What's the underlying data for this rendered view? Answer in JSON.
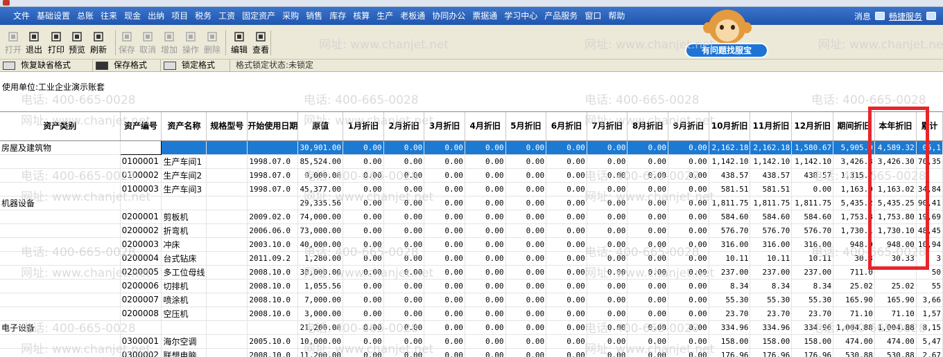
{
  "menu": {
    "items": [
      "文件",
      "基础设置",
      "总账",
      "往来",
      "现金",
      "出纳",
      "项目",
      "税务",
      "工资",
      "固定资产",
      "采购",
      "销售",
      "库存",
      "核算",
      "生产",
      "老板通",
      "协同办公",
      "票据通",
      "学习中心",
      "产品服务",
      "窗口",
      "帮助"
    ],
    "message": "消息",
    "quick_service": "畅捷服务"
  },
  "toolbar": {
    "buttons": [
      {
        "label": "打开",
        "icon": "open-folder-icon",
        "enabled": false
      },
      {
        "label": "退出",
        "icon": "exit-door-icon",
        "enabled": true
      },
      {
        "label": "打印",
        "icon": "printer-icon",
        "enabled": true
      },
      {
        "label": "预览",
        "icon": "preview-icon",
        "enabled": true
      },
      {
        "label": "刷新",
        "icon": "refresh-icon",
        "enabled": true
      },
      {
        "label": "保存",
        "icon": "save-disk-icon",
        "enabled": false
      },
      {
        "label": "取消",
        "icon": "cancel-icon",
        "enabled": false
      },
      {
        "label": "增加",
        "icon": "add-icon",
        "enabled": false
      },
      {
        "label": "操作",
        "icon": "operate-icon",
        "enabled": false
      },
      {
        "label": "删除",
        "icon": "delete-x-icon",
        "enabled": false
      },
      {
        "label": "编辑",
        "icon": "edit-icon",
        "enabled": true
      },
      {
        "label": "查看",
        "icon": "view-icon",
        "enabled": true
      }
    ]
  },
  "helper": {
    "bubble": "有问题找服宝"
  },
  "format_bar": {
    "restore": "恢复缺省格式",
    "save": "保存格式",
    "lock": "锁定格式",
    "status": "格式锁定状态:未锁定"
  },
  "report": {
    "unit_label": "使用单位:工业企业演示账套"
  },
  "watermark": {
    "phone": "电话: 400-665-0028",
    "site": "网址: www.chanjet.net"
  },
  "table": {
    "headers": [
      "资产类别",
      "资产编号",
      "资产名称",
      "规格型号",
      "开始使用日期",
      "原值",
      "1月折旧",
      "2月折旧",
      "3月折旧",
      "4月折旧",
      "5月折旧",
      "6月折旧",
      "7月折旧",
      "8月折旧",
      "9月折旧",
      "10月折旧",
      "11月折旧",
      "12月折旧",
      "期间折旧",
      "本年折旧",
      "累计"
    ],
    "rows": [
      {
        "cat": "房屋及建筑物",
        "code": "",
        "name": "",
        "spec": "",
        "date": "",
        "orig": "30,901.00",
        "m": [
          "0.00",
          "0.00",
          "0.00",
          "0.00",
          "0.00",
          "0.00",
          "0.00",
          "0.00",
          "0.00",
          "2,162.18",
          "2,162.18",
          "1,580.67"
        ],
        "period": "5,905.0",
        "year": "4,589.32",
        "acc": "05,1",
        "selected": true
      },
      {
        "cat": "",
        "code": "0100001",
        "name": "生产车间1",
        "spec": "",
        "date": "1998.07.0",
        "orig": "85,524.00",
        "m": [
          "0.00",
          "0.00",
          "0.00",
          "0.00",
          "0.00",
          "0.00",
          "0.00",
          "0.00",
          "0.00",
          "1,142.10",
          "1,142.10",
          "1,142.10"
        ],
        "period": "3,426.3",
        "year": "3,426.30",
        "acc": "70,35"
      },
      {
        "cat": "",
        "code": "0100002",
        "name": "生产车间2",
        "spec": "",
        "date": "1998.07.0",
        "orig": "0,000.00",
        "m": [
          "0.00",
          "0.00",
          "0.00",
          "0.00",
          "0.00",
          "0.00",
          "0.00",
          "0.00",
          "0.00",
          "438.57",
          "438.57",
          "438.57"
        ],
        "period": "1,315.7",
        "year": "",
        "acc": ""
      },
      {
        "cat": "",
        "code": "0100003",
        "name": "生产车间3",
        "spec": "",
        "date": "1998.07.0",
        "orig": "45,377.00",
        "m": [
          "0.00",
          "0.00",
          "0.00",
          "0.00",
          "0.00",
          "0.00",
          "0.00",
          "0.00",
          "0.00",
          "581.51",
          "581.51",
          "0.00"
        ],
        "period": "1,163.0",
        "year": "1,163.02",
        "acc": "34,84"
      },
      {
        "cat": "机器设备",
        "code": "",
        "name": "",
        "spec": "",
        "date": "",
        "orig": "29,335.56",
        "m": [
          "0.00",
          "0.00",
          "0.00",
          "0.00",
          "0.00",
          "0.00",
          "0.00",
          "0.00",
          "0.00",
          "1,811.75",
          "1,811.75",
          "1,811.75"
        ],
        "period": "5,435.2",
        "year": "5,435.25",
        "acc": "90,41"
      },
      {
        "cat": "",
        "code": "0200001",
        "name": "剪板机",
        "spec": "",
        "date": "2009.02.0",
        "orig": "74,000.00",
        "m": [
          "0.00",
          "0.00",
          "0.00",
          "0.00",
          "0.00",
          "0.00",
          "0.00",
          "0.00",
          "0.00",
          "584.60",
          "584.60",
          "584.60"
        ],
        "period": "1,753.8",
        "year": "1,753.80",
        "acc": "19,69"
      },
      {
        "cat": "",
        "code": "0200002",
        "name": "折弯机",
        "spec": "",
        "date": "2006.06.0",
        "orig": "73,000.00",
        "m": [
          "0.00",
          "0.00",
          "0.00",
          "0.00",
          "0.00",
          "0.00",
          "0.00",
          "0.00",
          "0.00",
          "576.70",
          "576.70",
          "576.70"
        ],
        "period": "1,730.1",
        "year": "1,730.10",
        "acc": "48,45"
      },
      {
        "cat": "",
        "code": "0200003",
        "name": "冲床",
        "spec": "",
        "date": "2003.10.0",
        "orig": "40,000.00",
        "m": [
          "0.00",
          "0.00",
          "0.00",
          "0.00",
          "0.00",
          "0.00",
          "0.00",
          "0.00",
          "0.00",
          "316.00",
          "316.00",
          "316.00"
        ],
        "period": "948.0",
        "year": "948.00",
        "acc": "10,94"
      },
      {
        "cat": "",
        "code": "0200004",
        "name": "台式钻床",
        "spec": "",
        "date": "2011.09.2",
        "orig": "1,280.00",
        "m": [
          "0.00",
          "0.00",
          "0.00",
          "0.00",
          "0.00",
          "0.00",
          "0.00",
          "0.00",
          "0.00",
          "10.11",
          "10.11",
          "10.11"
        ],
        "period": "30.3",
        "year": "30.33",
        "acc": "3"
      },
      {
        "cat": "",
        "code": "0200005",
        "name": "多工位母线",
        "spec": "",
        "date": "2008.10.0",
        "orig": "30,000.00",
        "m": [
          "0.00",
          "0.00",
          "0.00",
          "0.00",
          "0.00",
          "0.00",
          "0.00",
          "0.00",
          "0.00",
          "237.00",
          "237.00",
          "237.00"
        ],
        "period": "711.0",
        "year": "",
        "acc": "50"
      },
      {
        "cat": "",
        "code": "0200006",
        "name": "切排机",
        "spec": "",
        "date": "2008.10.0",
        "orig": "1,055.56",
        "m": [
          "0.00",
          "0.00",
          "0.00",
          "0.00",
          "0.00",
          "0.00",
          "0.00",
          "0.00",
          "0.00",
          "8.34",
          "8.34",
          "8.34"
        ],
        "period": "25.02",
        "year": "25.02",
        "acc": "55"
      },
      {
        "cat": "",
        "code": "0200007",
        "name": "喷涂机",
        "spec": "",
        "date": "2008.10.0",
        "orig": "7,000.00",
        "m": [
          "0.00",
          "0.00",
          "0.00",
          "0.00",
          "0.00",
          "0.00",
          "0.00",
          "0.00",
          "0.00",
          "55.30",
          "55.30",
          "55.30"
        ],
        "period": "165.90",
        "year": "165.90",
        "acc": "3,66"
      },
      {
        "cat": "",
        "code": "0200008",
        "name": "空压机",
        "spec": "",
        "date": "2008.10.0",
        "orig": "3,000.00",
        "m": [
          "0.00",
          "0.00",
          "0.00",
          "0.00",
          "0.00",
          "0.00",
          "0.00",
          "0.00",
          "0.00",
          "23.70",
          "23.70",
          "23.70"
        ],
        "period": "71.10",
        "year": "71.10",
        "acc": "1,57"
      },
      {
        "cat": "电子设备",
        "code": "",
        "name": "",
        "spec": "",
        "date": "",
        "orig": "21,200.00",
        "m": [
          "0.00",
          "0.00",
          "0.00",
          "0.00",
          "0.00",
          "0.00",
          "0.00",
          "0.00",
          "0.00",
          "334.96",
          "334.96",
          "334.96"
        ],
        "period": "1,004.88",
        "year": "1,004.88",
        "acc": "8,15"
      },
      {
        "cat": "",
        "code": "0300001",
        "name": "海尔空调",
        "spec": "",
        "date": "2005.10.0",
        "orig": "10,000.00",
        "m": [
          "0.00",
          "0.00",
          "0.00",
          "0.00",
          "0.00",
          "0.00",
          "0.00",
          "0.00",
          "0.00",
          "158.00",
          "158.00",
          "158.00"
        ],
        "period": "474.00",
        "year": "474.00",
        "acc": "5,47"
      },
      {
        "cat": "",
        "code": "0300002",
        "name": "联想电脑",
        "spec": "",
        "date": "2008.10.0",
        "orig": "11,200.00",
        "m": [
          "0.00",
          "0.00",
          "0.00",
          "0.00",
          "0.00",
          "0.00",
          "0.00",
          "0.00",
          "0.00",
          "176.96",
          "176.96",
          "176.96"
        ],
        "period": "530.88",
        "year": "530.88",
        "acc": "2,67"
      }
    ]
  }
}
